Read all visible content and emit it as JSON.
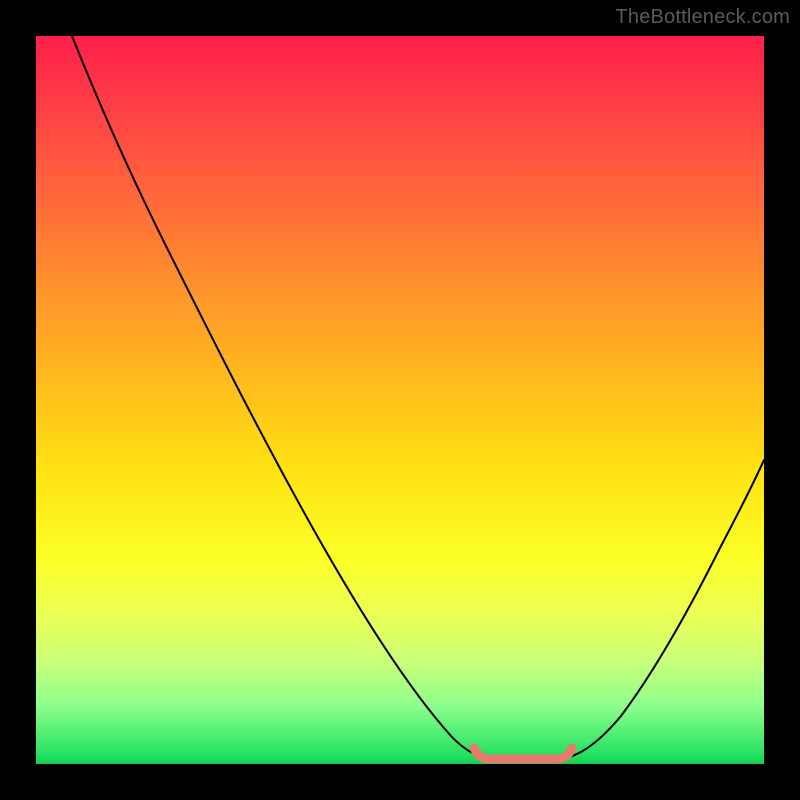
{
  "watermark": "TheBottleneck.com",
  "chart_data": {
    "type": "line",
    "title": "",
    "xlabel": "",
    "ylabel": "",
    "xlim": [
      0,
      100
    ],
    "ylim": [
      0,
      100
    ],
    "grid": false,
    "legend": false,
    "series": [
      {
        "name": "bottleneck-curve",
        "x": [
          5,
          12,
          20,
          28,
          36,
          44,
          52,
          58,
          62,
          66,
          70,
          76,
          82,
          88,
          94,
          100
        ],
        "values": [
          100,
          88,
          74,
          60,
          46,
          32,
          17,
          6,
          1,
          0,
          0,
          3,
          12,
          24,
          38,
          52
        ]
      }
    ],
    "annotations": [
      {
        "name": "optimal-range",
        "x_start": 60,
        "x_end": 72,
        "y": 1
      }
    ],
    "background_gradient": [
      "#ff1f4b",
      "#ffe312",
      "#20e060"
    ]
  }
}
